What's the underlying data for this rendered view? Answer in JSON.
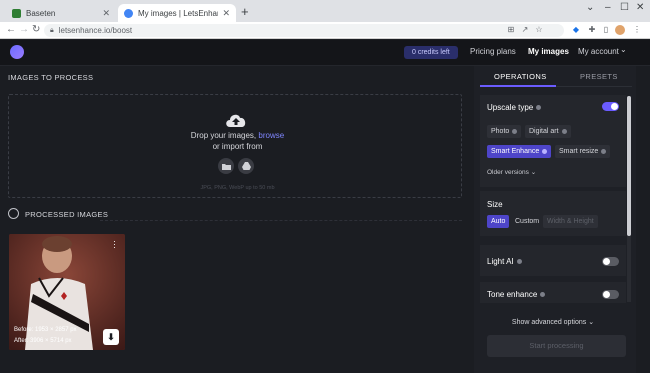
{
  "browser": {
    "tabs": [
      {
        "title": "Baseten",
        "favicon_color": "#2e7d32",
        "active": false
      },
      {
        "title": "My images | LetsEnhance.io – Im",
        "favicon_color": "#4285f4",
        "active": true
      }
    ],
    "new_tab": "+",
    "url": "letsenhance.io/boost"
  },
  "header": {
    "credits": "0 credits left",
    "nav": [
      "Pricing plans",
      "My images",
      "My account"
    ]
  },
  "images_panel": {
    "title": "IMAGES TO PROCESS",
    "drop_text": "Drop your images,",
    "browse": "browse",
    "import_text": "or import from",
    "hint": "JPG, PNG, WebP up to 50 mb"
  },
  "processed": {
    "title": "PROCESSED IMAGES",
    "items": [
      {
        "before": "Before: 1953 × 2857 px",
        "after": "After: 3906 × 5714 px"
      }
    ]
  },
  "right_panel": {
    "tabs": [
      "OPERATIONS",
      "PRESETS"
    ],
    "upscale": {
      "title": "Upscale type",
      "enabled": true,
      "options": [
        "Photo",
        "Digital art",
        "Smart Enhance",
        "Smart resize"
      ],
      "selected": "Smart Enhance",
      "older": "Older versions"
    },
    "size": {
      "title": "Size",
      "options": [
        "Auto",
        "Custom",
        "Width & Height"
      ],
      "selected": "Auto"
    },
    "light_ai": {
      "title": "Light AI",
      "enabled": false
    },
    "tone_enhance": {
      "title": "Tone enhance",
      "enabled": false
    },
    "advanced": "Show advanced options",
    "start": "Start processing"
  },
  "colors": {
    "accent": "#6b5cff",
    "background": "#1b1d22"
  }
}
